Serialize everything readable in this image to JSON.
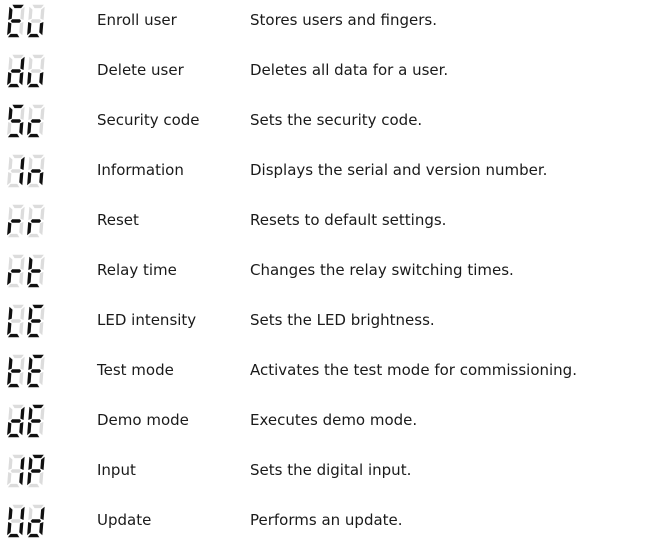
{
  "colors": {
    "segment_on": "#111111",
    "segment_off": "#dcdcdc",
    "text": "#1a1a1a"
  },
  "items": [
    {
      "code": "Eu",
      "name": "Enroll user",
      "description": "Stores users and fingers."
    },
    {
      "code": "du",
      "name": "Delete user",
      "description": "Deletes all data for a user."
    },
    {
      "code": "Sc",
      "name": "Security code",
      "description": "Sets the security code."
    },
    {
      "code": "In",
      "name": "Information",
      "description": "Displays the serial and version number."
    },
    {
      "code": "rr",
      "name": "Reset",
      "description": "Resets to default settings."
    },
    {
      "code": "rt",
      "name": "Relay time",
      "description": "Changes the relay switching times."
    },
    {
      "code": "LE",
      "name": "LED intensity",
      "description": "Sets the LED brightness."
    },
    {
      "code": "tE",
      "name": "Test mode",
      "description": "Activates the test mode for commissioning."
    },
    {
      "code": "dE",
      "name": "Demo mode",
      "description": "Executes demo mode."
    },
    {
      "code": "IP",
      "name": "Input",
      "description": "Sets the digital input."
    },
    {
      "code": "Ud",
      "name": "Update",
      "description": "Performs an update."
    }
  ]
}
